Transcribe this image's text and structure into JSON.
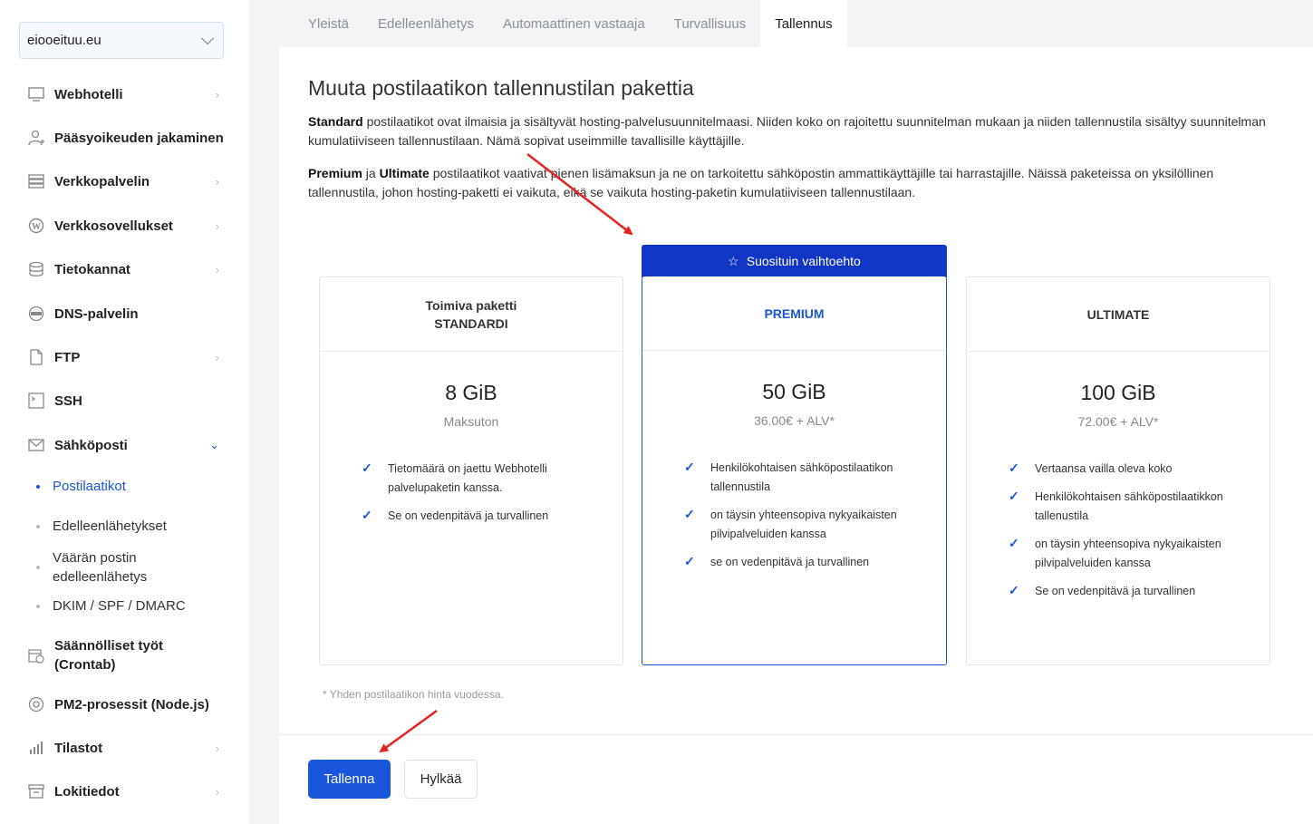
{
  "sidebar": {
    "domain": "eiooeituu.eu",
    "items": [
      {
        "label": "Webhotelli",
        "icon": "monitor-icon",
        "arrow": true
      },
      {
        "label": "Pääsyoikeuden jakaminen",
        "icon": "user-add-icon",
        "arrow": false
      },
      {
        "label": "Verkkopalvelin",
        "icon": "server-icon",
        "arrow": true
      },
      {
        "label": "Verkkosovellukset",
        "icon": "wordpress-icon",
        "arrow": true
      },
      {
        "label": "Tietokannat",
        "icon": "database-icon",
        "arrow": true
      },
      {
        "label": "DNS-palvelin",
        "icon": "dns-icon",
        "arrow": false
      },
      {
        "label": "FTP",
        "icon": "file-icon",
        "arrow": true
      },
      {
        "label": "SSH",
        "icon": "terminal-icon",
        "arrow": false
      },
      {
        "label": "Sähköposti",
        "icon": "mail-icon",
        "arrow": true
      },
      {
        "label": "Säännölliset työt (Crontab)",
        "icon": "calendar-clock-icon",
        "arrow": false
      },
      {
        "label": "PM2-prosessit (Node.js)",
        "icon": "node-icon",
        "arrow": false
      },
      {
        "label": "Tilastot",
        "icon": "chart-icon",
        "arrow": true
      },
      {
        "label": "Lokitiedot",
        "icon": "archive-icon",
        "arrow": true
      }
    ],
    "email_sub": [
      {
        "label": "Postilaatikot",
        "active": true
      },
      {
        "label": "Edelleenlähetykset",
        "active": false
      },
      {
        "label": "Väärän postin edelleenlähetys",
        "active": false
      },
      {
        "label": "DKIM / SPF / DMARC",
        "active": false
      }
    ]
  },
  "tabs": [
    "Yleistä",
    "Edelleenlähetys",
    "Automaattinen vastaaja",
    "Turvallisuus",
    "Tallennus"
  ],
  "content": {
    "title": "Muuta postilaatikon tallennustilan pakettia",
    "p1_bold": "Standard",
    "p1_rest": " postilaatikot ovat ilmaisia ja sisältyvät hosting-palvelusuunnitelmaasi. Niiden koko on rajoitettu suunnitelman mukaan ja niiden tallennustila sisältyy suunnitelman kumulatiiviseen tallennustilaan. Nämä sopivat useimmille tavallisille käyttäjille.",
    "p2_bold1": "Premium",
    "p2_mid": " ja ",
    "p2_bold2": "Ultimate",
    "p2_rest": " postilaatikot vaativat pienen lisämaksun ja ne on tarkoitettu sähköpostin ammattikäyttäjille tai harrastajille. Näissä paketeissa on yksilöllinen tallennustila, johon hosting-paketti ei vaikuta, eikä se vaikuta hosting-paketin kumulatiiviseen tallennustilaan.",
    "banner": "Suosituin vaihtoehto",
    "note": "* Yhden postilaatikon hinta vuodessa.",
    "save": "Tallenna",
    "cancel": "Hylkää"
  },
  "plans": [
    {
      "head_line1": "Toimiva paketti",
      "head_line2": "STANDARDI",
      "size": "8 GiB",
      "price": "Maksuton",
      "features": [
        "Tietomäärä on jaettu Webhotelli palvelupaketin kanssa.",
        "Se on vedenpitävä ja turvallinen"
      ]
    },
    {
      "head_line1": "PREMIUM",
      "head_line2": "",
      "size": "50 GiB",
      "price": "36.00€ + ALV*",
      "features": [
        "Henkilökohtaisen sähköpostilaatikon tallennustila",
        "on täysin yhteensopiva nykyaikaisten pilvipalveluiden kanssa",
        "se on vedenpitävä ja turvallinen"
      ]
    },
    {
      "head_line1": "ULTIMATE",
      "head_line2": "",
      "size": "100 GiB",
      "price": "72.00€ + ALV*",
      "features": [
        "Vertaansa vailla oleva koko",
        "Henkilökohtaisen sähköpostilaatikkon tallenustila",
        "on täysin yhteensopiva nykyaikaisten pilvipalveluiden kanssa",
        "Se on vedenpitävä ja turvallinen"
      ]
    }
  ],
  "colors": {
    "accent": "#1a56db",
    "banner": "#1036c6",
    "annotation_arrow": "#e5221c"
  }
}
